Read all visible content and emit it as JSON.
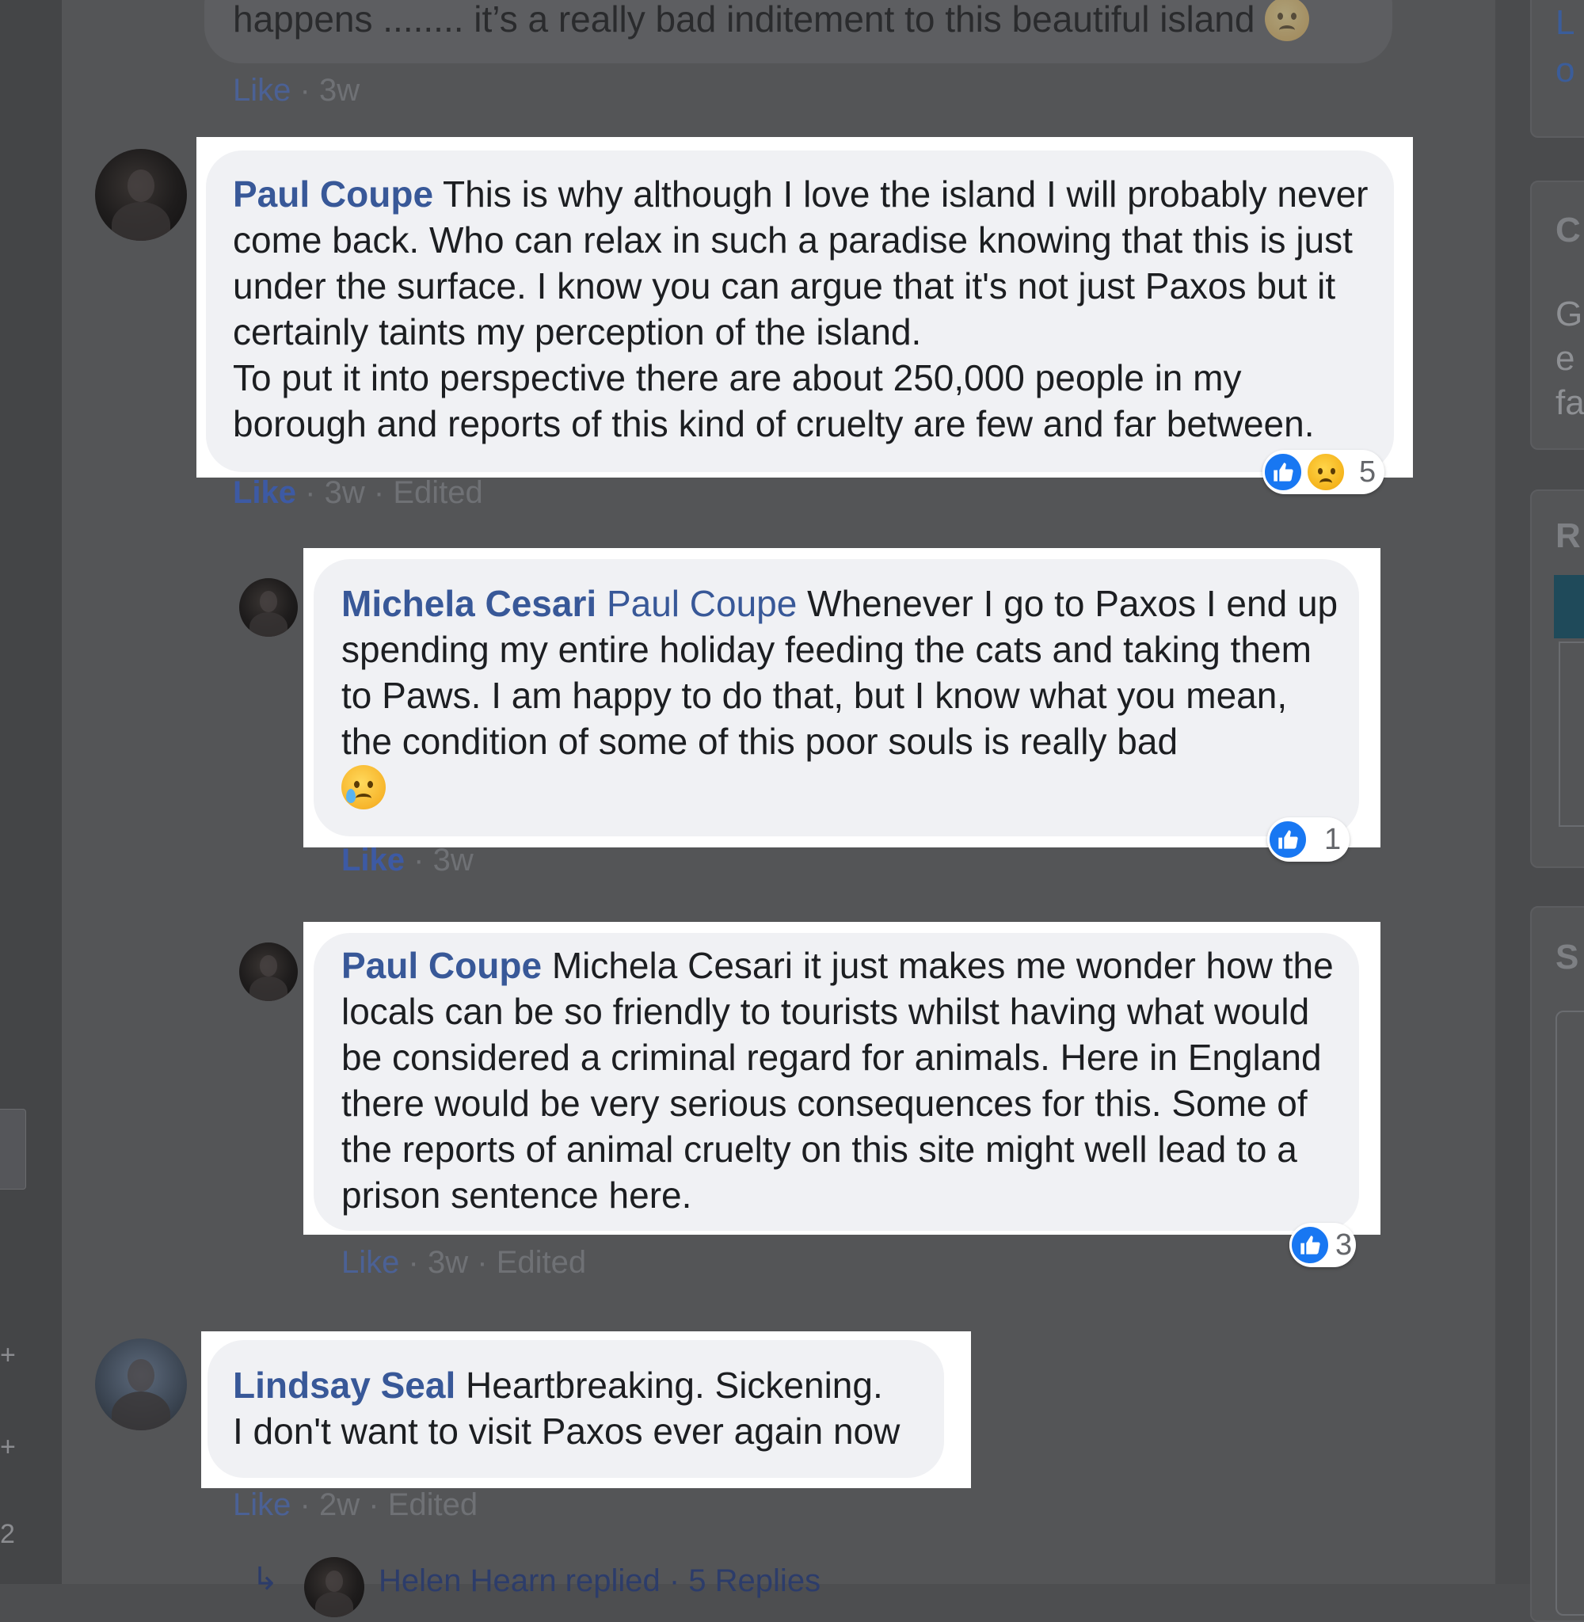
{
  "prev_comment": {
    "text": "happens ........ it’s a really bad inditement to this beautiful island",
    "emoji_icon": "grimacing-face-emoji",
    "like_label": "Like",
    "time": "3w"
  },
  "comments": [
    {
      "author": "Paul Coupe",
      "mention": "",
      "text": "This is why although I love the island I will probably never come back. Who can relax in such a paradise knowing that this is just under the surface. I know you can argue that it's not just Paxos but it certainly taints my perception of the island.\nTo put it into perspective there are about 250,000 people in my borough and reports of this kind of cruelty are few and far between.",
      "reaction_count": "5",
      "reaction_icons": [
        "like-icon",
        "sad-icon"
      ],
      "like_label": "Like",
      "time": "3w",
      "edited": "Edited"
    },
    {
      "author": "Michela Cesari",
      "mention": "Paul Coupe",
      "text": "Whenever I go to Paxos I end up spending my entire holiday feeding the cats and taking them to Paws. I am happy to do that, but I know what you mean, the condition of some of this poor souls is really bad",
      "emoji_icon": "crying-face-emoji",
      "reaction_count": "1",
      "reaction_icons": [
        "like-icon"
      ],
      "like_label": "Like",
      "time": "3w"
    },
    {
      "author": "Paul Coupe",
      "mention": "",
      "text": "Michela Cesari it just makes me wonder how the locals can be so friendly to tourists whilst having what would be considered a criminal regard for animals. Here in England there would be very serious consequences for this. Some of the reports of animal cruelty on this site might well lead to a prison sentence here.",
      "reaction_count": "3",
      "reaction_icons": [
        "like-icon"
      ],
      "like_label": "Like",
      "time": "3w",
      "edited": "Edited"
    },
    {
      "author": "Lindsay Seal",
      "mention": "",
      "text": "Heartbreaking. Sickening.\nI don't want to visit Paxos ever again now",
      "like_label": "Like",
      "time": "2w",
      "edited": "Edited"
    }
  ],
  "replies_link": "Helen Hearn replied · 5 Replies",
  "sep": "·",
  "right_col_fragments": [
    "L",
    "o",
    "C",
    "G",
    "e",
    "fa",
    "R",
    "S"
  ],
  "colors": {
    "author_link": "#385898",
    "bubble_bg": "#f0f1f4",
    "highlight": "#ffffff",
    "like_blue": "#1877f2",
    "overlay_bg": "#545557"
  }
}
